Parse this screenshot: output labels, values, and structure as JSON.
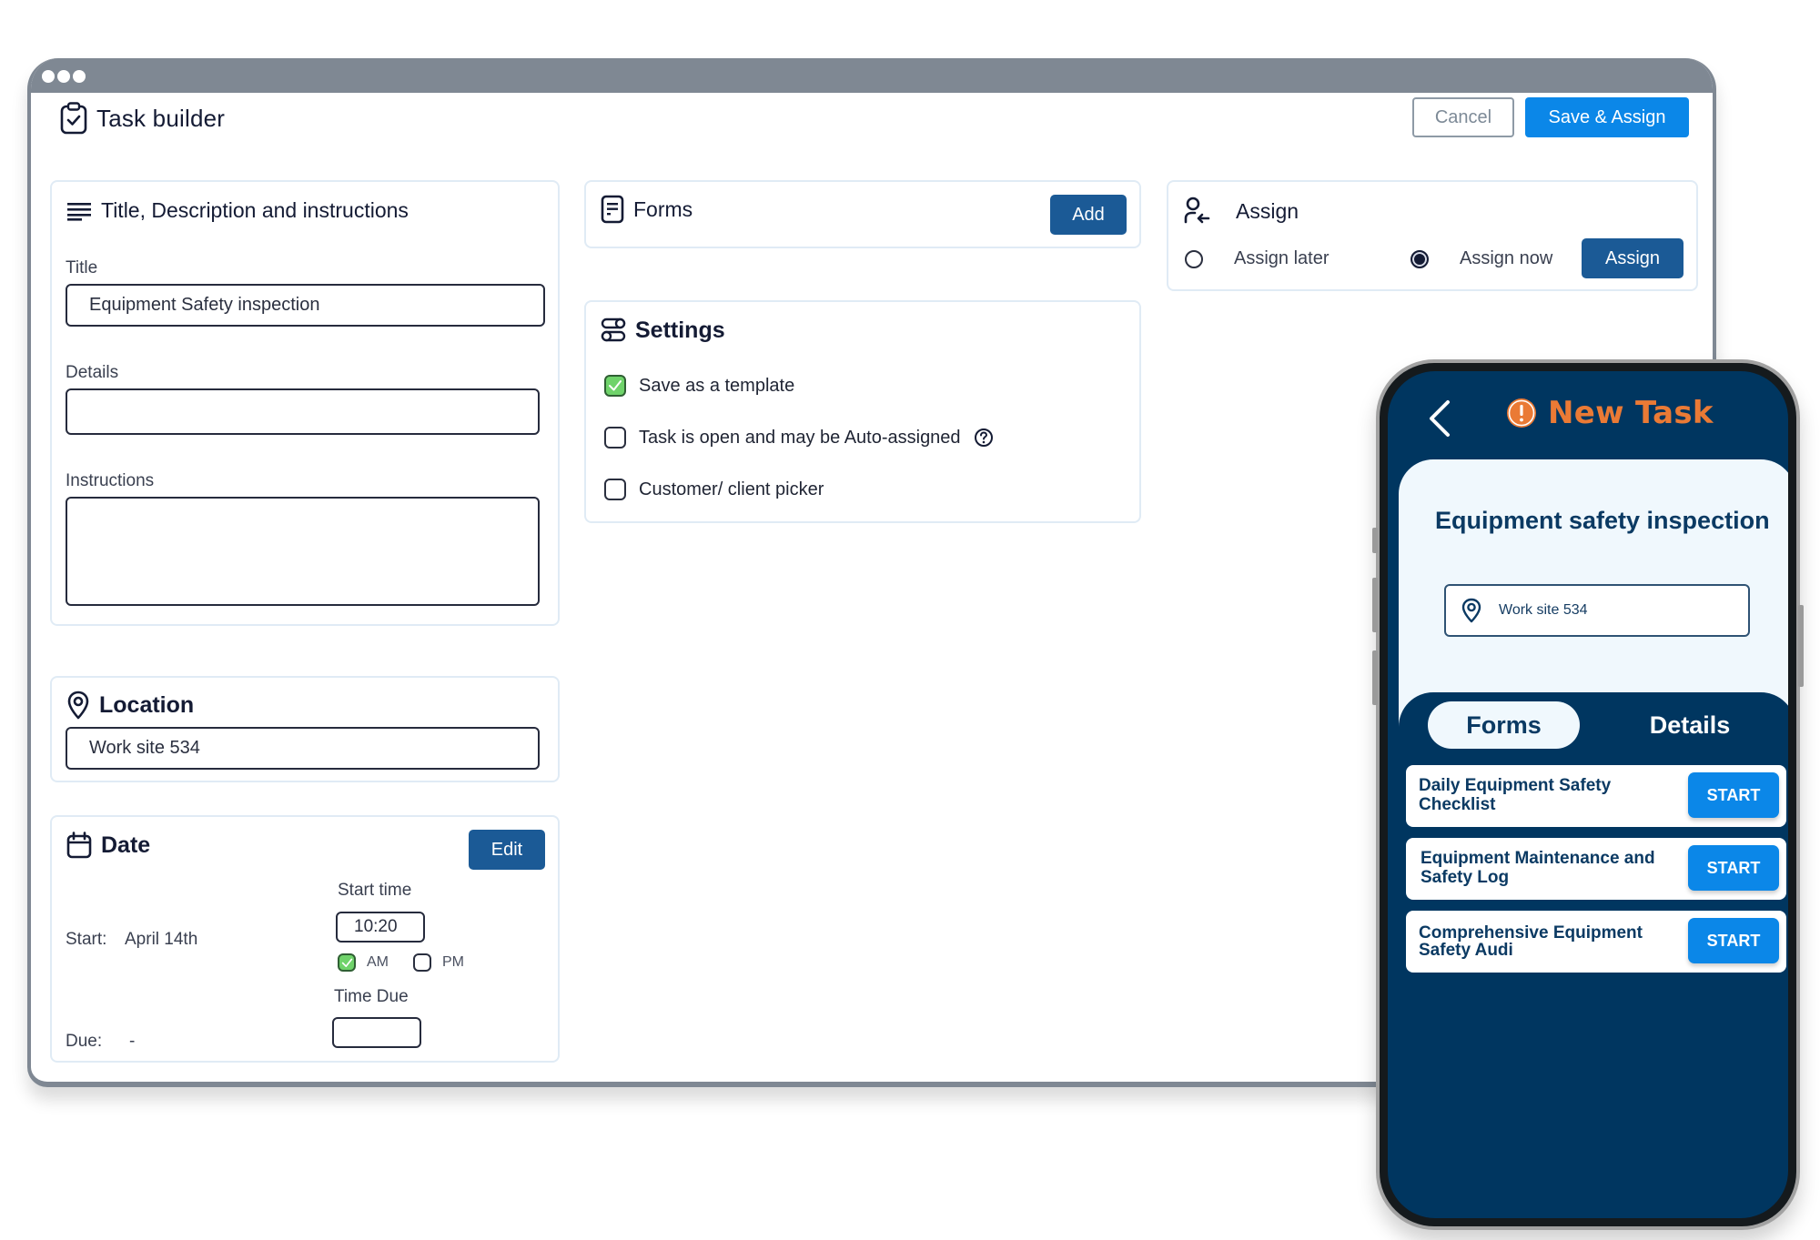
{
  "window": {
    "title": "Task builder",
    "buttons": {
      "cancel": "Cancel",
      "save_assign": "Save & Assign"
    }
  },
  "details_panel": {
    "heading": "Title, Description and instructions",
    "title_label": "Title",
    "title_value": "Equipment Safety inspection",
    "details_label": "Details",
    "details_value": "",
    "instructions_label": "Instructions",
    "instructions_value": ""
  },
  "forms_panel": {
    "heading": "Forms",
    "add_label": "Add"
  },
  "settings_panel": {
    "heading": "Settings",
    "options": [
      {
        "label": "Save as a template",
        "checked": true
      },
      {
        "label": "Task is open and may be Auto-assigned",
        "checked": false,
        "help": true
      },
      {
        "label": "Customer/ client picker",
        "checked": false
      }
    ]
  },
  "assign_panel": {
    "heading": "Assign",
    "options": [
      {
        "label": "Assign later",
        "selected": false
      },
      {
        "label": "Assign now",
        "selected": true
      }
    ],
    "assign_label": "Assign"
  },
  "location_panel": {
    "heading": "Location",
    "value": "Work site 534"
  },
  "date_panel": {
    "heading": "Date",
    "edit_label": "Edit",
    "start_label": "Start:",
    "start_value": "April 14th",
    "due_label": "Due:",
    "due_value": "-",
    "start_time_label": "Start time",
    "start_time_value": "10:20",
    "am_label": "AM",
    "am_checked": true,
    "pm_label": "PM",
    "pm_checked": false,
    "time_due_label": "Time Due",
    "time_due_value": ""
  },
  "phone": {
    "header_title": "New Task",
    "task_title": "Equipment safety inspection",
    "location": "Work site 534",
    "tabs": [
      {
        "label": "Forms",
        "active": true
      },
      {
        "label": "Details",
        "active": false
      }
    ],
    "forms": [
      {
        "name": "Daily Equipment Safety Checklist",
        "action": "START"
      },
      {
        "name": "Equipment Maintenance and Safety Log",
        "action": "START"
      },
      {
        "name": "Comprehensive Equipment Safety Audi",
        "action": "START"
      }
    ],
    "colors": {
      "navy": "#003660",
      "accent_orange": "#ea7a35",
      "button_blue": "#0b87e8"
    }
  },
  "colors": {
    "primary_blue": "#0b87e8",
    "dark_blue": "#1b5a96",
    "check_green": "#6fd36a",
    "titlebar_gray": "#7f8893"
  }
}
